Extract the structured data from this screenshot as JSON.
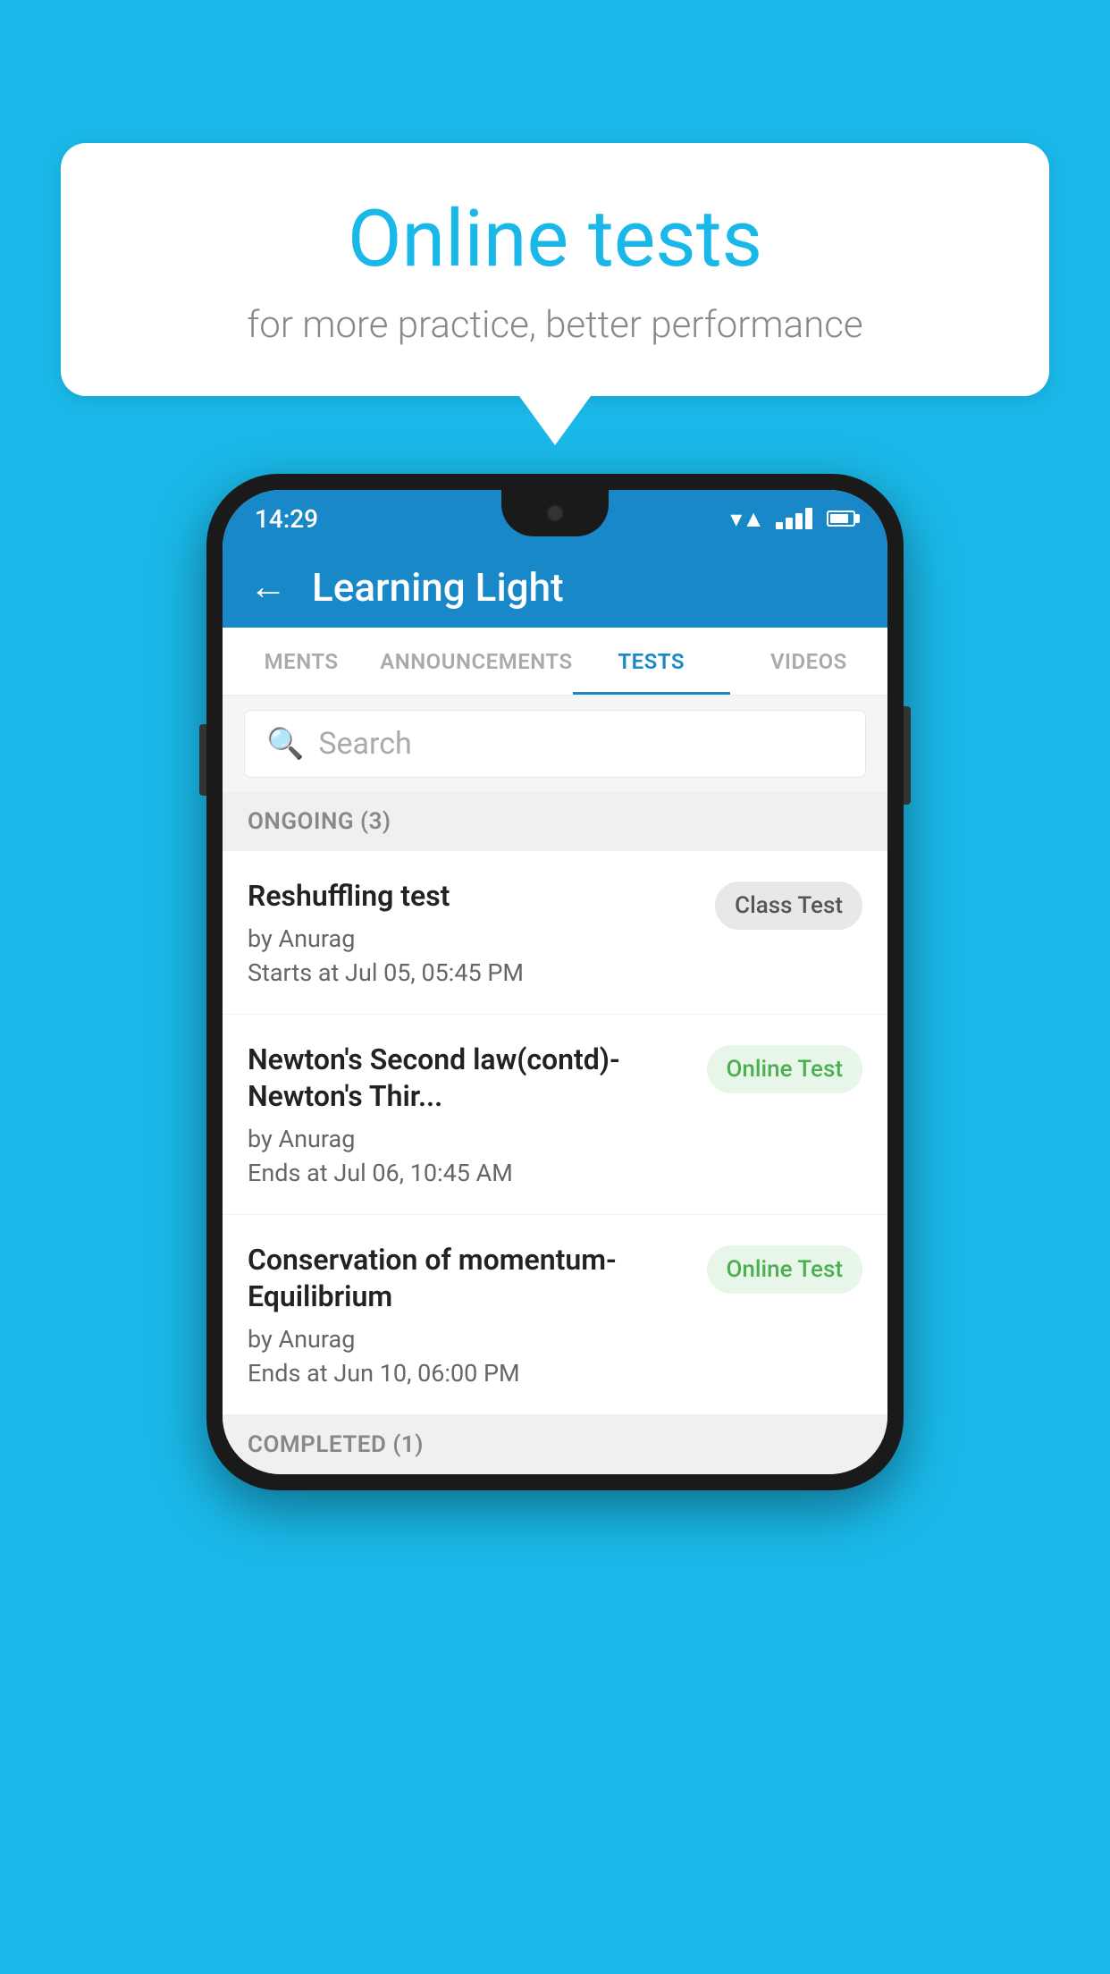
{
  "background_color": "#1ab8e8",
  "speech_bubble": {
    "title": "Online tests",
    "subtitle": "for more practice, better performance"
  },
  "phone": {
    "status_bar": {
      "time": "14:29"
    },
    "app_bar": {
      "title": "Learning Light",
      "back_label": "←"
    },
    "tabs": [
      {
        "label": "MENTS",
        "active": false
      },
      {
        "label": "ANNOUNCEMENTS",
        "active": false
      },
      {
        "label": "TESTS",
        "active": true
      },
      {
        "label": "VIDEOS",
        "active": false
      }
    ],
    "search": {
      "placeholder": "Search"
    },
    "ongoing_section": {
      "title": "ONGOING (3)"
    },
    "tests": [
      {
        "name": "Reshuffling test",
        "author": "by Anurag",
        "date": "Starts at  Jul 05, 05:45 PM",
        "badge": "Class Test",
        "badge_type": "class"
      },
      {
        "name": "Newton's Second law(contd)-Newton's Thir...",
        "author": "by Anurag",
        "date": "Ends at  Jul 06, 10:45 AM",
        "badge": "Online Test",
        "badge_type": "online"
      },
      {
        "name": "Conservation of momentum-Equilibrium",
        "author": "by Anurag",
        "date": "Ends at  Jun 10, 06:00 PM",
        "badge": "Online Test",
        "badge_type": "online"
      }
    ],
    "completed_section": {
      "title": "COMPLETED (1)"
    }
  }
}
